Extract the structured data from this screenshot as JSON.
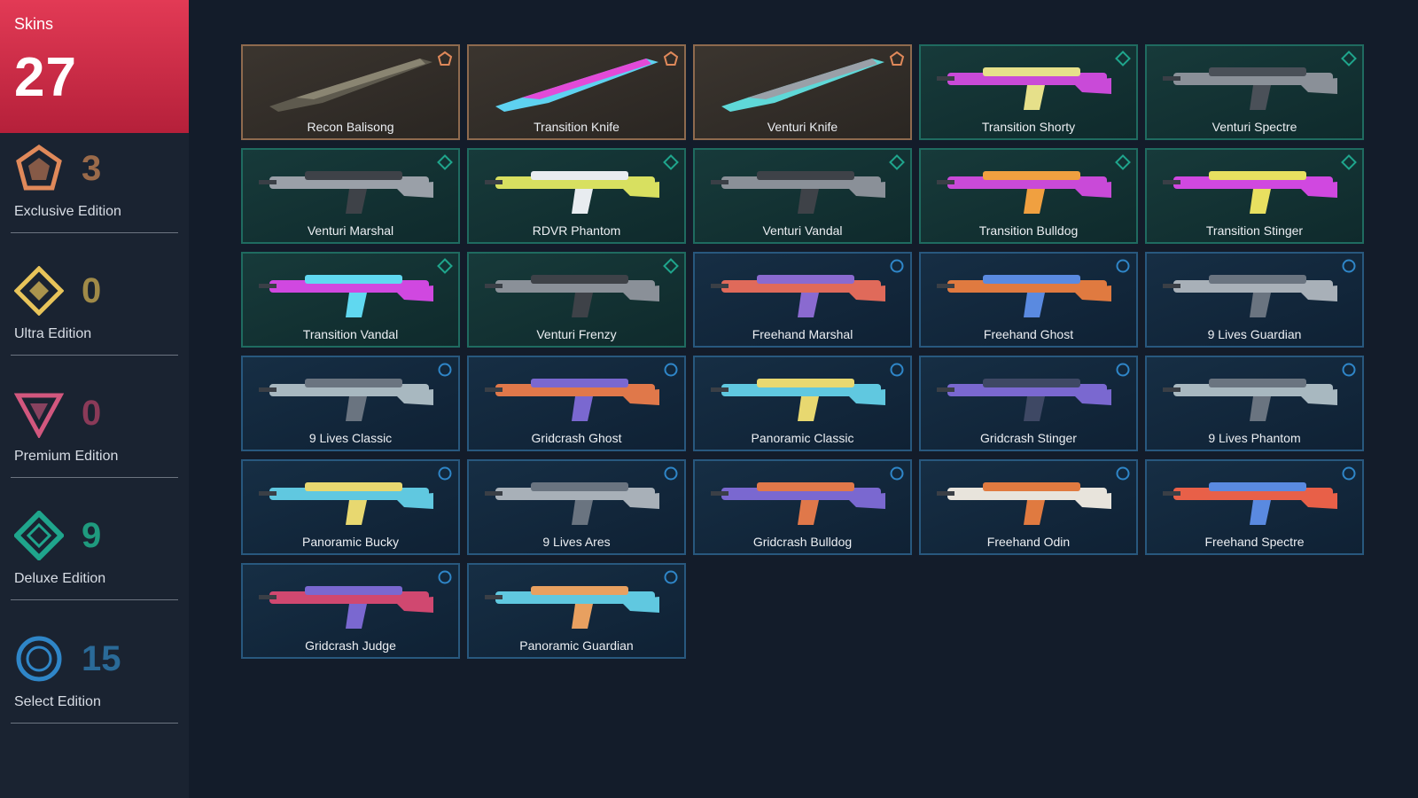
{
  "summary": {
    "label": "Skins",
    "total": "27"
  },
  "tiers": [
    {
      "name": "Exclusive Edition",
      "count": "3",
      "color": "#e0895a",
      "icon": "exclusive-edition-icon"
    },
    {
      "name": "Ultra Edition",
      "count": "0",
      "color": "#e8c45a",
      "icon": "ultra-edition-icon"
    },
    {
      "name": "Premium Edition",
      "count": "0",
      "color": "#d2577e",
      "icon": "premium-edition-icon"
    },
    {
      "name": "Deluxe Edition",
      "count": "9",
      "color": "#1fa58c",
      "icon": "deluxe-edition-icon"
    },
    {
      "name": "Select Edition",
      "count": "15",
      "color": "#2f86c8",
      "icon": "select-edition-icon"
    }
  ],
  "skins": [
    {
      "name": "Recon Balisong",
      "tier": "exclusive",
      "colors": [
        "#8a8572",
        "#5e5a4e"
      ]
    },
    {
      "name": "Transition Knife",
      "tier": "exclusive",
      "colors": [
        "#e24ad8",
        "#5ed2f0"
      ]
    },
    {
      "name": "Venturi Knife",
      "tier": "exclusive",
      "colors": [
        "#9aa0a8",
        "#5fd8d8"
      ]
    },
    {
      "name": "Transition Shorty",
      "tier": "deluxe",
      "colors": [
        "#c94ad8",
        "#e6e08a"
      ]
    },
    {
      "name": "Venturi Spectre",
      "tier": "deluxe",
      "colors": [
        "#8a9098",
        "#4a5058"
      ]
    },
    {
      "name": "Venturi Marshal",
      "tier": "deluxe",
      "colors": [
        "#9aa0a8",
        "#3e4248"
      ]
    },
    {
      "name": "RDVR Phantom",
      "tier": "deluxe",
      "colors": [
        "#d8e060",
        "#e8ecf0"
      ]
    },
    {
      "name": "Venturi Vandal",
      "tier": "deluxe",
      "colors": [
        "#8a9098",
        "#3e4248"
      ]
    },
    {
      "name": "Transition Bulldog",
      "tier": "deluxe",
      "colors": [
        "#c94ad8",
        "#f0a040"
      ]
    },
    {
      "name": "Transition Stinger",
      "tier": "deluxe",
      "colors": [
        "#d048e0",
        "#e8e060"
      ]
    },
    {
      "name": "Transition Vandal",
      "tier": "deluxe",
      "colors": [
        "#d048e0",
        "#60d8f0"
      ]
    },
    {
      "name": "Venturi Frenzy",
      "tier": "deluxe",
      "colors": [
        "#8a9098",
        "#3e4248"
      ]
    },
    {
      "name": "Freehand Marshal",
      "tier": "select",
      "colors": [
        "#e06a5a",
        "#8a6ad0"
      ]
    },
    {
      "name": "Freehand Ghost",
      "tier": "select",
      "colors": [
        "#e07a40",
        "#5a8ae0"
      ]
    },
    {
      "name": "9 Lives Guardian",
      "tier": "select",
      "colors": [
        "#a8b0b8",
        "#6a7480"
      ]
    },
    {
      "name": "9 Lives Classic",
      "tier": "select",
      "colors": [
        "#a8b8c0",
        "#6a7480"
      ]
    },
    {
      "name": "Gridcrash Ghost",
      "tier": "select",
      "colors": [
        "#e0784a",
        "#7a68d0"
      ]
    },
    {
      "name": "Panoramic Classic",
      "tier": "select",
      "colors": [
        "#60c8e0",
        "#e8d870"
      ]
    },
    {
      "name": "Gridcrash Stinger",
      "tier": "select",
      "colors": [
        "#7a68d0",
        "#3e4864"
      ]
    },
    {
      "name": "9 Lives Phantom",
      "tier": "select",
      "colors": [
        "#a8b8c0",
        "#6a7480"
      ]
    },
    {
      "name": "Panoramic Bucky",
      "tier": "select",
      "colors": [
        "#60c8e0",
        "#e8d870"
      ]
    },
    {
      "name": "9 Lives Ares",
      "tier": "select",
      "colors": [
        "#a8b0b8",
        "#6a7480"
      ]
    },
    {
      "name": "Gridcrash Bulldog",
      "tier": "select",
      "colors": [
        "#7a68d0",
        "#e0784a"
      ]
    },
    {
      "name": "Freehand Odin",
      "tier": "select",
      "colors": [
        "#e8e4dc",
        "#e07a40"
      ]
    },
    {
      "name": "Freehand Spectre",
      "tier": "select",
      "colors": [
        "#e86048",
        "#5a8ae0"
      ]
    },
    {
      "name": "Gridcrash Judge",
      "tier": "select",
      "colors": [
        "#d04870",
        "#7a68d0"
      ]
    },
    {
      "name": "Panoramic Guardian",
      "tier": "select",
      "colors": [
        "#60c8e0",
        "#e8a060"
      ]
    }
  ]
}
